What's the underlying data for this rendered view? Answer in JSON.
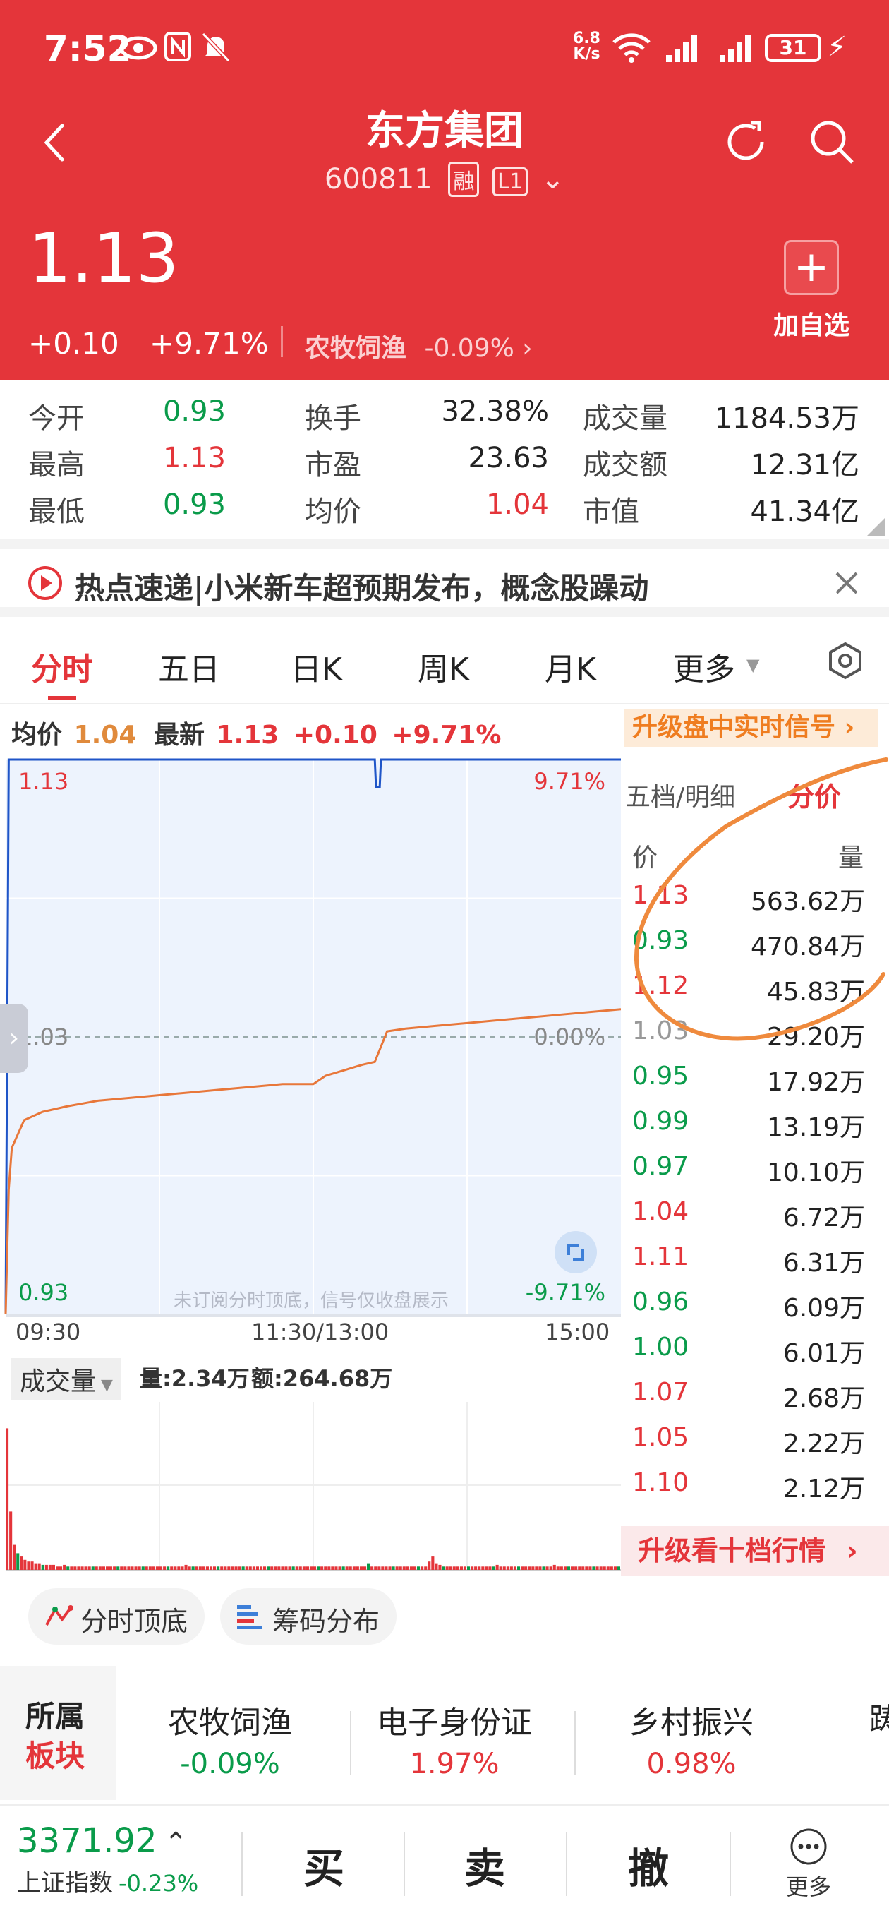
{
  "status_bar": {
    "time": "7:52",
    "net_speed_top": "6.8",
    "net_speed_bottom": "K/s",
    "battery": "31"
  },
  "header": {
    "stock_name": "东方集团",
    "stock_code": "600811",
    "margin_badge": "融",
    "level_badge": "L1",
    "price": "1.13",
    "change": "+0.10",
    "change_pct": "+9.71%",
    "sector_name": "农牧饲渔",
    "sector_change": "-0.09%",
    "add_watch_label": "加自选"
  },
  "stats": [
    {
      "label": "今开",
      "value": "0.93",
      "color": "green"
    },
    {
      "label": "换手",
      "value": "32.38%",
      "color": "dark"
    },
    {
      "label": "成交量",
      "value": "1184.53万",
      "color": "dark"
    },
    {
      "label": "最高",
      "value": "1.13",
      "color": "red"
    },
    {
      "label": "市盈",
      "value": "23.63",
      "color": "dark"
    },
    {
      "label": "成交额",
      "value": "12.31亿",
      "color": "dark"
    },
    {
      "label": "最低",
      "value": "0.93",
      "color": "green"
    },
    {
      "label": "均价",
      "value": "1.04",
      "color": "red"
    },
    {
      "label": "市值",
      "value": "41.34亿",
      "color": "dark"
    }
  ],
  "news": {
    "text": "热点速递|小米新车超预期发布，概念股躁动"
  },
  "tabs": [
    "分时",
    "五日",
    "日K",
    "周K",
    "月K",
    "更多"
  ],
  "chart_info": {
    "avg_label": "均价",
    "avg_value": "1.04",
    "latest_label": "最新",
    "latest_value": "1.13",
    "change": "+0.10",
    "change_pct": "+9.71%",
    "upgrade_signal": "升级盘中实时信号"
  },
  "chart_data": {
    "type": "line",
    "y_top_label": "1.13",
    "y_mid_label": "1.03",
    "y_bottom_label": "0.93",
    "pct_top": "9.71%",
    "pct_mid": "0.00%",
    "pct_bottom": "-9.71%",
    "ylim": [
      0.93,
      1.13
    ],
    "x_labels": [
      "09:30",
      "11:30/13:00",
      "15:00"
    ],
    "watermark": "未订阅分时顶底，信号仅收盘展示",
    "price_series": {
      "x": [
        0,
        0.02,
        0.04,
        0.08,
        0.25,
        0.5,
        0.6,
        0.99,
        1
      ],
      "values": [
        0.93,
        1.13,
        1.13,
        1.13,
        1.13,
        1.13,
        1.12,
        1.13,
        1.13
      ]
    },
    "avg_series": {
      "x": [
        0,
        0.005,
        0.01,
        0.03,
        0.06,
        0.1,
        0.15,
        0.2,
        0.25,
        0.3,
        0.35,
        0.4,
        0.45,
        0.5,
        0.52,
        0.55,
        0.58,
        0.6,
        0.62,
        0.65,
        0.7,
        0.75,
        0.8,
        0.85,
        0.9,
        0.95,
        1
      ],
      "values": [
        0.93,
        0.975,
        0.99,
        1.0,
        1.003,
        1.005,
        1.007,
        1.008,
        1.009,
        1.01,
        1.011,
        1.012,
        1.013,
        1.013,
        1.016,
        1.018,
        1.02,
        1.021,
        1.032,
        1.033,
        1.034,
        1.035,
        1.036,
        1.037,
        1.038,
        1.039,
        1.04
      ]
    },
    "volume": {
      "label": "成交量",
      "qty_label": "量:2.34万",
      "amt_label": "额:264.68万",
      "bars": [
        0.85,
        0.35,
        0.15,
        0.1,
        0.08,
        0.06,
        0.05,
        0.05,
        0.04,
        0.04,
        0.03,
        0.03,
        0.03,
        0.03,
        0.02,
        0.02,
        0.03,
        0.02,
        0.02,
        0.02,
        0.02,
        0.02,
        0.02,
        0.02,
        0.02,
        0.02,
        0.02,
        0.02,
        0.02,
        0.02,
        0.02,
        0.02,
        0.02,
        0.02,
        0.02,
        0.02,
        0.02,
        0.02,
        0.02,
        0.02,
        0.02,
        0.02,
        0.02,
        0.02,
        0.02,
        0.02,
        0.02,
        0.02,
        0.02,
        0.02,
        0.03,
        0.02,
        0.02,
        0.02,
        0.02,
        0.02,
        0.02,
        0.02,
        0.02,
        0.02,
        0.02,
        0.02,
        0.02,
        0.02,
        0.02,
        0.02,
        0.02,
        0.02,
        0.02,
        0.02,
        0.02,
        0.02,
        0.02,
        0.02,
        0.02,
        0.02,
        0.02,
        0.02,
        0.02,
        0.02,
        0.02,
        0.02,
        0.02,
        0.02,
        0.02,
        0.02,
        0.02,
        0.02,
        0.02,
        0.02,
        0.02,
        0.02,
        0.02,
        0.02,
        0.02,
        0.02,
        0.02,
        0.02,
        0.02,
        0.02,
        0.02,
        0.04,
        0.02,
        0.02,
        0.02,
        0.02,
        0.02,
        0.02,
        0.02,
        0.02,
        0.02,
        0.02,
        0.02,
        0.02,
        0.02,
        0.02,
        0.02,
        0.02,
        0.05,
        0.08,
        0.04,
        0.03,
        0.02,
        0.02,
        0.02,
        0.02,
        0.02,
        0.02,
        0.02,
        0.02,
        0.02,
        0.02,
        0.02,
        0.02,
        0.02,
        0.02,
        0.02,
        0.03,
        0.02,
        0.02,
        0.02,
        0.02,
        0.02,
        0.02,
        0.02,
        0.02,
        0.02,
        0.02,
        0.02,
        0.02,
        0.02,
        0.02,
        0.02,
        0.03,
        0.02,
        0.02,
        0.02,
        0.02,
        0.02,
        0.02,
        0.02,
        0.02,
        0.02,
        0.02,
        0.02,
        0.02,
        0.02,
        0.02,
        0.02,
        0.02,
        0.02,
        0.02
      ]
    }
  },
  "order_book": {
    "tab_five": "五档/明细",
    "tab_price": "分价",
    "col_price": "价",
    "col_vol": "量",
    "rows": [
      {
        "price": "1.13",
        "vol": "563.62万",
        "color": "red"
      },
      {
        "price": "0.93",
        "vol": "470.84万",
        "color": "green"
      },
      {
        "price": "1.12",
        "vol": "45.83万",
        "color": "red"
      },
      {
        "price": "1.03",
        "vol": "29.20万",
        "color": "gray"
      },
      {
        "price": "0.95",
        "vol": "17.92万",
        "color": "green"
      },
      {
        "price": "0.99",
        "vol": "13.19万",
        "color": "green"
      },
      {
        "price": "0.97",
        "vol": "10.10万",
        "color": "green"
      },
      {
        "price": "1.04",
        "vol": "6.72万",
        "color": "red"
      },
      {
        "price": "1.11",
        "vol": "6.31万",
        "color": "red"
      },
      {
        "price": "0.96",
        "vol": "6.09万",
        "color": "green"
      },
      {
        "price": "1.00",
        "vol": "6.01万",
        "color": "green"
      },
      {
        "price": "1.07",
        "vol": "2.68万",
        "color": "red"
      },
      {
        "price": "1.05",
        "vol": "2.22万",
        "color": "red"
      },
      {
        "price": "1.10",
        "vol": "2.12万",
        "color": "red"
      }
    ],
    "upgrade_ten": "升级看十档行情"
  },
  "tools": {
    "top_bottom": "分时顶底",
    "chip_dist": "筹码分布"
  },
  "sectors": {
    "label_top": "所属",
    "label_bottom": "板块",
    "items": [
      {
        "name": "农牧饲渔",
        "change": "-0.09%",
        "color": "green"
      },
      {
        "name": "电子身份证",
        "change": "1.97%",
        "color": "red"
      },
      {
        "name": "乡村振兴",
        "change": "0.98%",
        "color": "red"
      }
    ]
  },
  "bottom_bar": {
    "index_value": "3371.92",
    "index_name": "上证指数",
    "index_change": "-0.23%",
    "buy": "买",
    "sell": "卖",
    "cancel": "撤",
    "more": "更多"
  }
}
